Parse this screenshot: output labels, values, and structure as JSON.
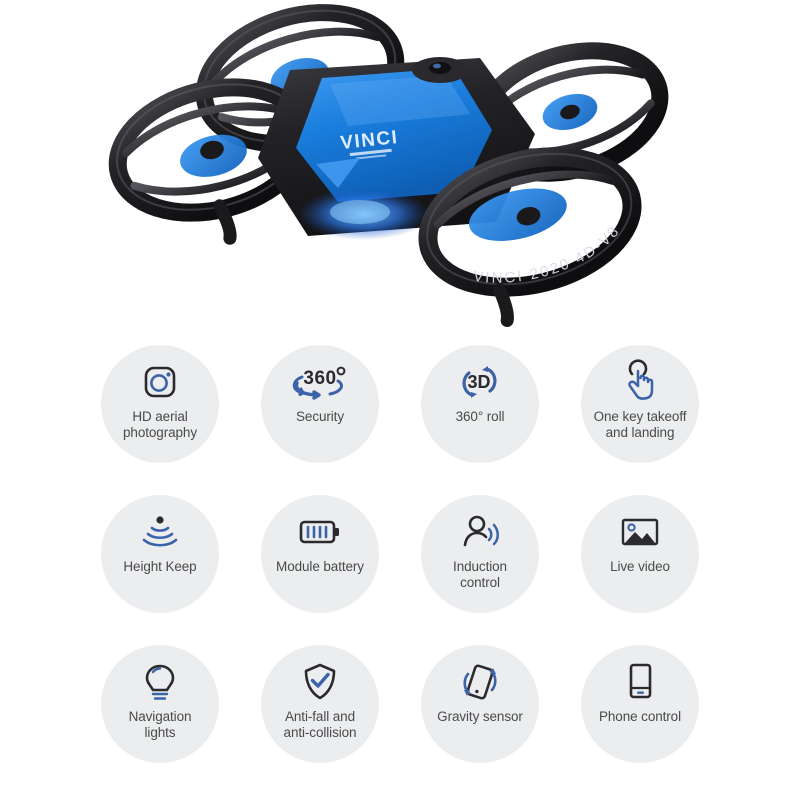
{
  "product": {
    "brand_logo_text": "VINCI",
    "body_model_text": "VINCI 2020 4D-V8",
    "image_alt": "quadcopter-drone",
    "colors": {
      "body_blue": "#1b7fe0",
      "frame_black": "#1c1c1e",
      "led_glow": "#2f7ff5",
      "background": "#ffffff"
    }
  },
  "theme": {
    "bubble_background": "#ebedef",
    "icon_dark": "#2b2b2f",
    "icon_blue": "#3c62a8",
    "label_color": "#4a4a4a"
  },
  "features": {
    "rows": 3,
    "columns": 4,
    "items": [
      {
        "id": "hd-aerial-photography",
        "icon": "camera-icon",
        "label": "HD aerial\nphotography"
      },
      {
        "id": "security",
        "icon": "360-degrees-icon",
        "label": "Security"
      },
      {
        "id": "360-roll",
        "icon": "3d-rotate-icon",
        "label": "360° roll"
      },
      {
        "id": "one-key-takeoff",
        "icon": "tap-hand-icon",
        "label": "One key takeoff\nand landing"
      },
      {
        "id": "height-keep",
        "icon": "altitude-wave-icon",
        "label": "Height Keep"
      },
      {
        "id": "module-battery",
        "icon": "battery-icon",
        "label": "Module battery"
      },
      {
        "id": "induction-control",
        "icon": "person-signal-icon",
        "label": "Induction\ncontrol"
      },
      {
        "id": "live-video",
        "icon": "photo-image-icon",
        "label": "Live video"
      },
      {
        "id": "navigation-lights",
        "icon": "lightbulb-icon",
        "label": "Navigation\nlights"
      },
      {
        "id": "anti-fall",
        "icon": "shield-check-icon",
        "label": "Anti-fall and\nanti-collision"
      },
      {
        "id": "gravity-sensor",
        "icon": "phone-rotate-icon",
        "label": "Gravity sensor"
      },
      {
        "id": "phone-control",
        "icon": "smartphone-icon",
        "label": "Phone control"
      }
    ]
  }
}
